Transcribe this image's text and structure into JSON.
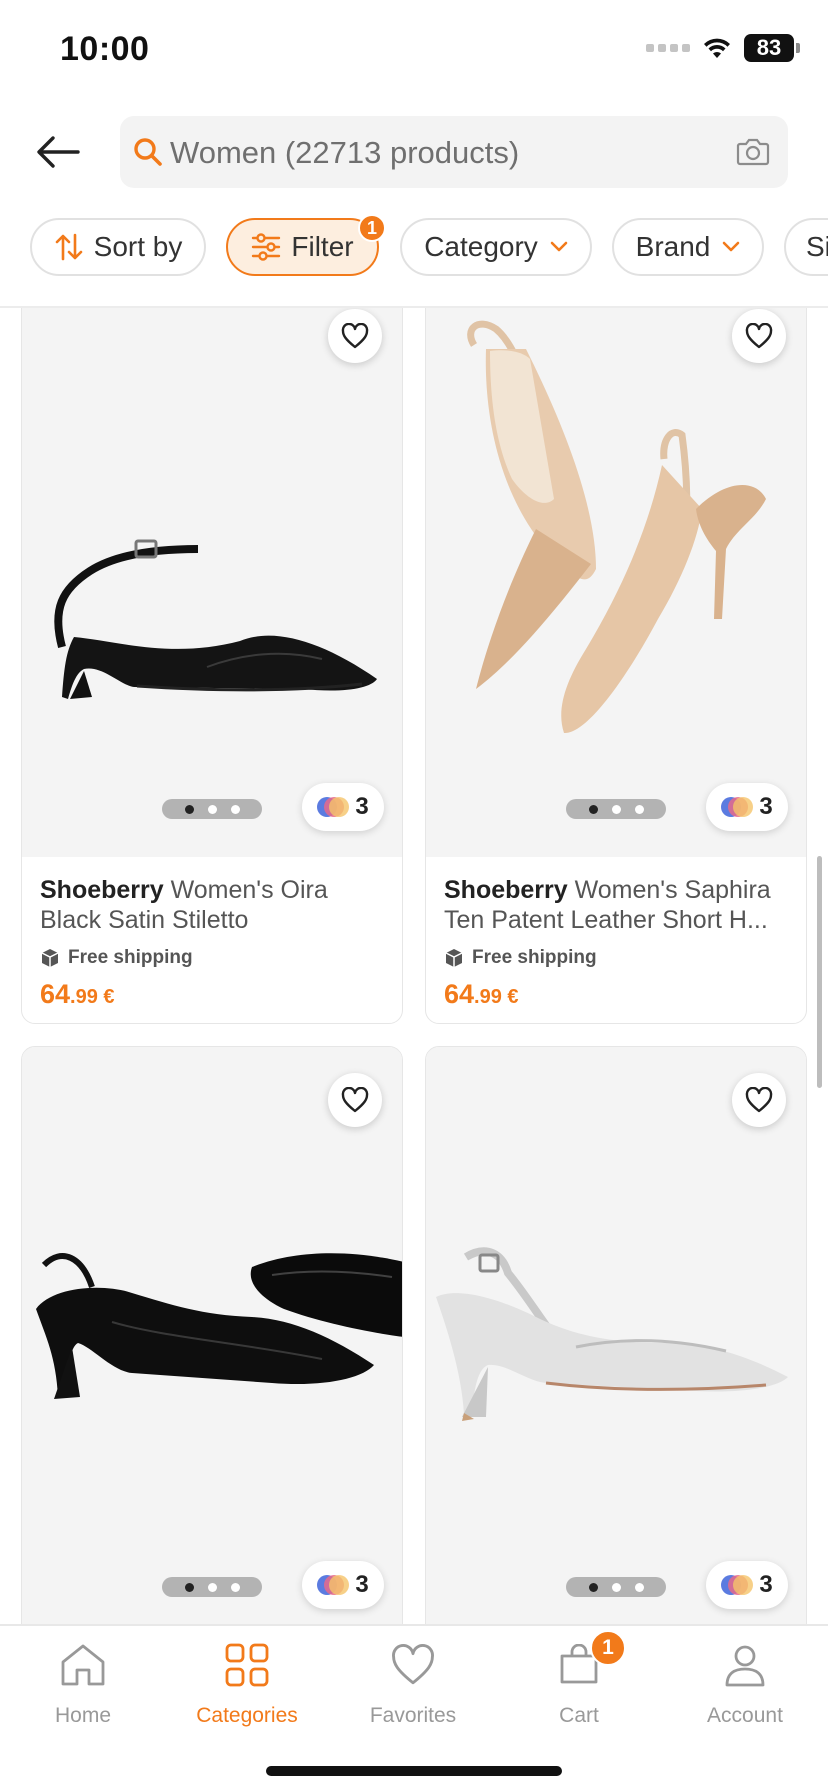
{
  "status_bar": {
    "time": "10:00",
    "battery": "83"
  },
  "search": {
    "text": "Women (22713 products)"
  },
  "chips": [
    {
      "label": "Sort by"
    },
    {
      "label": "Filter",
      "badge": "1"
    },
    {
      "label": "Category"
    },
    {
      "label": "Brand"
    },
    {
      "label": "Si"
    }
  ],
  "products": [
    {
      "brand": "Shoeberry",
      "name": "Women's Oira Black Satin Stiletto",
      "shipping": "Free shipping",
      "price_int": "64",
      "price_dec": ".99 €",
      "colors": "3"
    },
    {
      "brand": "Shoeberry",
      "name": "Women's Saphira Ten Patent Leather Short H...",
      "shipping": "Free shipping",
      "price_int": "64",
      "price_dec": ".99 €",
      "colors": "3"
    },
    {
      "colors": "3"
    },
    {
      "colors": "3"
    }
  ],
  "nav": {
    "home": "Home",
    "categories": "Categories",
    "favorites": "Favorites",
    "cart": "Cart",
    "cart_badge": "1",
    "account": "Account"
  },
  "colors": {
    "accent": "#f27a1a",
    "text": "#333333",
    "muted": "#999999"
  },
  "icons": [
    "back-arrow-icon",
    "search-icon",
    "camera-icon",
    "sort-icon",
    "filter-icon",
    "chevron-down-icon",
    "heart-icon",
    "box-icon",
    "home-icon",
    "categories-icon",
    "cart-icon",
    "account-icon"
  ]
}
